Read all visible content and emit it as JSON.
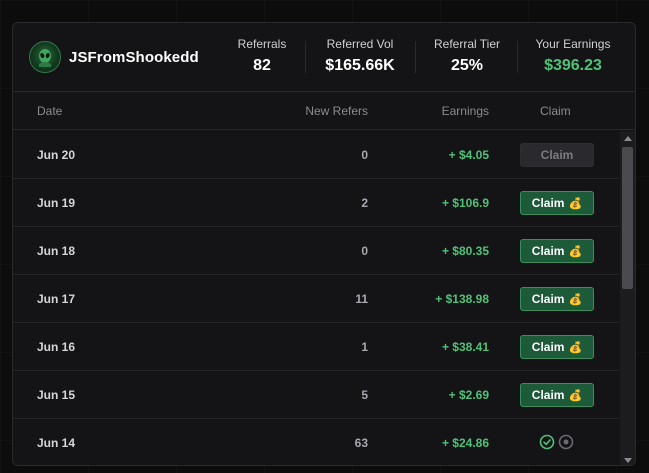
{
  "profile": {
    "username": "JSFromShookedd"
  },
  "stats": [
    {
      "label": "Referrals",
      "value": "82"
    },
    {
      "label": "Referred Vol",
      "value": "$165.66K"
    },
    {
      "label": "Referral Tier",
      "value": "25%"
    },
    {
      "label": "Your Earnings",
      "value": "$396.23"
    }
  ],
  "table": {
    "columns": [
      "Date",
      "New Refers",
      "Earnings",
      "Claim"
    ],
    "rows": [
      {
        "date": "Jun 20",
        "refers": "0",
        "earnings": "+ $4.05",
        "claim": "Claim",
        "state": "disabled"
      },
      {
        "date": "Jun 19",
        "refers": "2",
        "earnings": "+ $106.9",
        "claim": "Claim",
        "state": "active"
      },
      {
        "date": "Jun 18",
        "refers": "0",
        "earnings": "+ $80.35",
        "claim": "Claim",
        "state": "active"
      },
      {
        "date": "Jun 17",
        "refers": "11",
        "earnings": "+ $138.98",
        "claim": "Claim",
        "state": "active"
      },
      {
        "date": "Jun 16",
        "refers": "1",
        "earnings": "+ $38.41",
        "claim": "Claim",
        "state": "active"
      },
      {
        "date": "Jun 15",
        "refers": "5",
        "earnings": "+ $2.69",
        "claim": "Claim",
        "state": "active"
      },
      {
        "date": "Jun 14",
        "refers": "63",
        "earnings": "+ $24.86",
        "claim": "",
        "state": "claimed"
      }
    ]
  },
  "colors": {
    "accent_green": "#4fc27a",
    "button_bg": "#1d5a3a",
    "panel_bg": "#141416"
  },
  "icons": {
    "avatar": "alien-avatar-icon",
    "claim": "money-bag-icon",
    "claimed": "check-circle-icon",
    "pending": "circle-dot-icon"
  }
}
